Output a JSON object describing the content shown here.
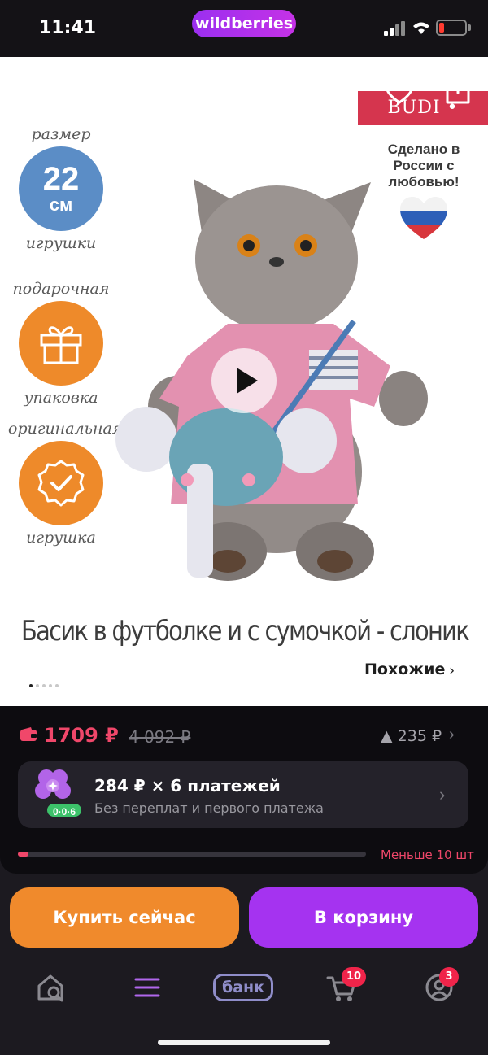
{
  "status_bar": {
    "time": "11:41",
    "brand": "wildberries"
  },
  "product": {
    "brand_logo": "BUDI • BASA",
    "title": "Басик в футболке и с сумочкой - слоник",
    "badges": [
      {
        "top": "размер",
        "value": "22",
        "unit": "см",
        "bottom": "игрушки"
      },
      {
        "top": "подарочная",
        "bottom": "упаковка",
        "icon": "gift-icon"
      },
      {
        "top": "оригинальная",
        "bottom": "игрушка",
        "icon": "check-seal-icon"
      }
    ],
    "made_in": "Сделано в России с любовью!",
    "similar_label": "Похожие",
    "image_count": 5,
    "image_index": 1
  },
  "price": {
    "current": "1709 ₽",
    "old": "4 092 ₽",
    "increase": "▲ 235 ₽"
  },
  "installment": {
    "title": "284 ₽ × 6 платежей",
    "subtitle": "Без переплат и первого платежа",
    "badge": "0·0·6"
  },
  "stock": {
    "label": "Меньше 10 шт",
    "fraction": 0.03
  },
  "actions": {
    "buy_now": "Купить сейчас",
    "add_to_cart": "В корзину"
  },
  "nav": {
    "bank_label": "банк",
    "cart_badge": "10",
    "profile_badge": "3"
  },
  "colors": {
    "accent_purple": "#a533f0",
    "accent_orange": "#f08a2c",
    "price_red": "#f0476a"
  }
}
